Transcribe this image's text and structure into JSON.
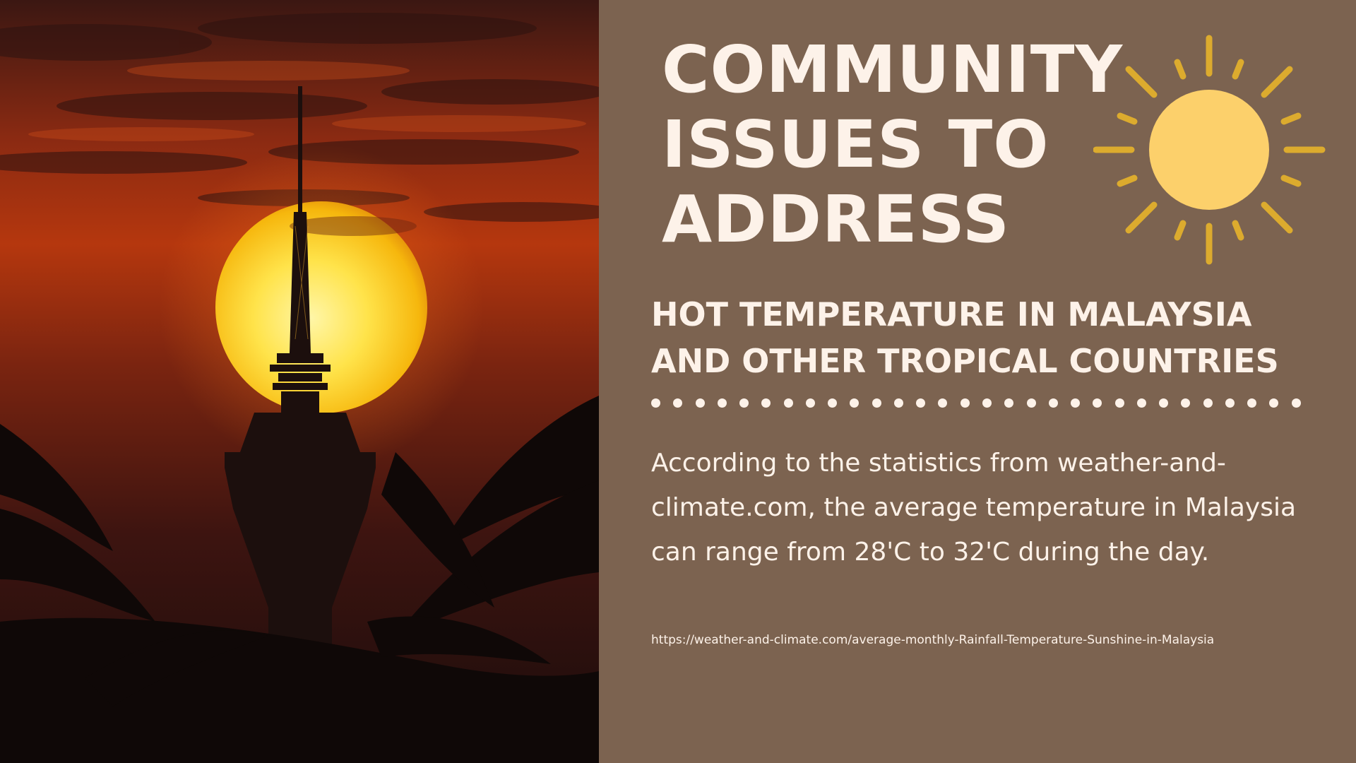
{
  "title": "COMMUNITY ISSUES TO ADDRESS",
  "subtitle": "HOT TEMPERATURE IN MALAYSIA AND OTHER TROPICAL COUNTRIES",
  "body": "According to the statistics from weather-and-climate.com, the average temperature in Malaysia can range from 28'C to 32'C during the day.",
  "source_url": "https://weather-and-climate.com/average-monthly-Rainfall-Temperature-Sunshine-in-Malaysia",
  "photo": {
    "subject": "sunset behind telecommunications tower with palm silhouettes"
  },
  "icons": {
    "sun": "sun-icon"
  },
  "colors": {
    "panel_background": "#7c6350",
    "text": "#fdf2e9",
    "sun_core": "#fcd06b",
    "sun_rays": "#dcab2e"
  }
}
